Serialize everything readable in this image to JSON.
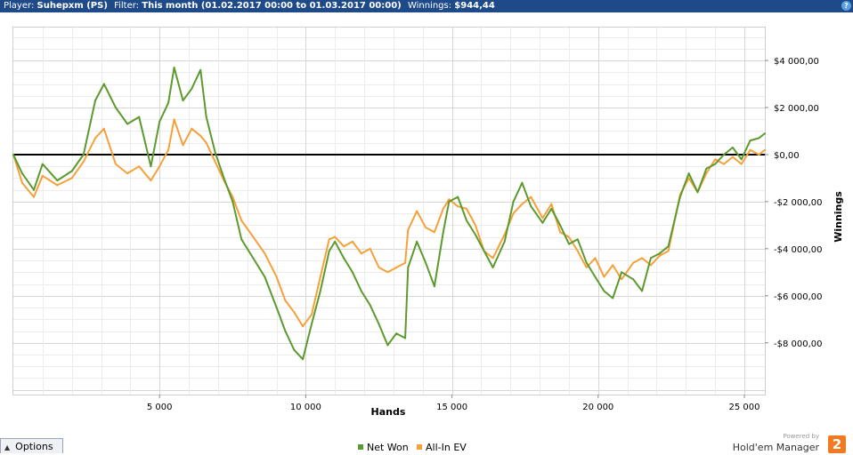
{
  "header": {
    "player_label": "Player:",
    "player_value": "Suhepxm (PS)",
    "filter_label": "Filter:",
    "filter_value": "This month (01.02.2017 00:00 to 01.03.2017 00:00)",
    "winnings_label": "Winnings:",
    "winnings_value": "$944,44",
    "help_icon": "?"
  },
  "options": {
    "label": "Options",
    "icon": "triangle-up-icon"
  },
  "legend": [
    {
      "label": "Net Won",
      "color": "#5c9a2e"
    },
    {
      "label": "All-In EV",
      "color": "#f6a03a"
    }
  ],
  "powered": {
    "small": "Powered by",
    "brand": "Hold'em Manager",
    "logo": "2"
  },
  "chart_data": {
    "type": "line",
    "xlabel": "Hands",
    "ylabel": "Winnings",
    "xlim": [
      0,
      25700
    ],
    "ylim": [
      -10200,
      5400
    ],
    "xticks": [
      5000,
      10000,
      15000,
      20000,
      25000
    ],
    "xtick_labels": [
      "5 000",
      "10 000",
      "15 000",
      "20 000",
      "25 000"
    ],
    "yticks": [
      4000,
      2000,
      0,
      -2000,
      -4000,
      -6000,
      -8000
    ],
    "ytick_labels": [
      "$4 000,00",
      "$2 000,00",
      "$0,00",
      "-$2 000,00",
      "-$4 000,00",
      "-$6 000,00",
      "-$8 000,00"
    ],
    "zero_line": true,
    "grid": true,
    "series": [
      {
        "name": "Net Won",
        "color": "#5c9a2e",
        "x": [
          0,
          300,
          700,
          1000,
          1500,
          2000,
          2400,
          2800,
          3100,
          3500,
          3900,
          4300,
          4700,
          5000,
          5300,
          5500,
          5800,
          6100,
          6400,
          6600,
          6900,
          7200,
          7500,
          7800,
          8200,
          8600,
          9000,
          9300,
          9600,
          9900,
          10200,
          10500,
          10800,
          11000,
          11300,
          11600,
          11900,
          12200,
          12500,
          12800,
          13100,
          13400,
          13500,
          13800,
          14100,
          14400,
          14700,
          14900,
          15200,
          15500,
          15800,
          16100,
          16400,
          16800,
          17100,
          17400,
          17700,
          18100,
          18400,
          18700,
          19000,
          19300,
          19600,
          19900,
          20200,
          20500,
          20800,
          21200,
          21500,
          21800,
          22100,
          22400,
          22800,
          23100,
          23400,
          23700,
          24000,
          24300,
          24600,
          24900,
          25200,
          25500,
          25700
        ],
        "y": [
          0,
          -800,
          -1500,
          -400,
          -1100,
          -700,
          0,
          2300,
          3000,
          2000,
          1300,
          1600,
          -500,
          1400,
          2200,
          3700,
          2300,
          2800,
          3600,
          1600,
          100,
          -1000,
          -2000,
          -3600,
          -4400,
          -5200,
          -6500,
          -7500,
          -8300,
          -8700,
          -7200,
          -5800,
          -4100,
          -3700,
          -4400,
          -5000,
          -5800,
          -6400,
          -7200,
          -8100,
          -7600,
          -7800,
          -4800,
          -3700,
          -4600,
          -5600,
          -3300,
          -2000,
          -1800,
          -2800,
          -3400,
          -4100,
          -4800,
          -3700,
          -2000,
          -1200,
          -2200,
          -2900,
          -2300,
          -3000,
          -3800,
          -3600,
          -4600,
          -5200,
          -5800,
          -6100,
          -5000,
          -5300,
          -5800,
          -4400,
          -4200,
          -3900,
          -1800,
          -800,
          -1600,
          -600,
          -400,
          0,
          300,
          -200,
          600,
          700,
          900
        ]
      },
      {
        "name": "All-In EV",
        "color": "#f6a03a",
        "x": [
          0,
          300,
          700,
          1000,
          1500,
          2000,
          2400,
          2800,
          3100,
          3500,
          3900,
          4300,
          4700,
          5000,
          5300,
          5500,
          5800,
          6100,
          6400,
          6600,
          6900,
          7200,
          7500,
          7800,
          8200,
          8600,
          9000,
          9300,
          9600,
          9900,
          10200,
          10500,
          10800,
          11000,
          11300,
          11600,
          11900,
          12200,
          12500,
          12800,
          13100,
          13400,
          13500,
          13800,
          14100,
          14400,
          14700,
          14900,
          15200,
          15500,
          15800,
          16100,
          16400,
          16800,
          17100,
          17400,
          17700,
          18100,
          18400,
          18700,
          19000,
          19300,
          19600,
          19900,
          20200,
          20500,
          20800,
          21200,
          21500,
          21800,
          22100,
          22400,
          22800,
          23100,
          23400,
          23700,
          24000,
          24300,
          24600,
          24900,
          25200,
          25500,
          25700
        ],
        "y": [
          0,
          -1200,
          -1800,
          -900,
          -1300,
          -1000,
          -300,
          700,
          1100,
          -400,
          -800,
          -500,
          -1100,
          -500,
          200,
          1500,
          400,
          1100,
          800,
          500,
          -300,
          -1100,
          -1800,
          -2800,
          -3500,
          -4200,
          -5200,
          -6200,
          -6700,
          -7300,
          -6800,
          -5200,
          -3600,
          -3500,
          -3900,
          -3700,
          -4200,
          -4000,
          -4800,
          -5000,
          -4800,
          -4600,
          -3200,
          -2400,
          -3100,
          -3300,
          -2300,
          -1900,
          -2200,
          -2300,
          -3000,
          -4100,
          -4400,
          -3400,
          -2500,
          -2100,
          -1800,
          -2700,
          -2100,
          -3300,
          -3500,
          -4100,
          -4800,
          -4400,
          -5200,
          -4700,
          -5300,
          -4600,
          -4400,
          -4700,
          -4300,
          -4100,
          -1700,
          -1000,
          -1600,
          -800,
          -200,
          -400,
          -100,
          -400,
          200,
          0,
          200
        ]
      }
    ]
  }
}
